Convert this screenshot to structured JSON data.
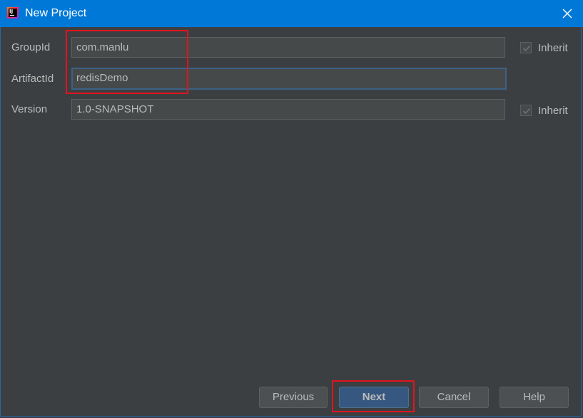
{
  "window": {
    "title": "New Project",
    "app_icon": "intellij-idea-icon",
    "close_icon": "close-icon"
  },
  "form": {
    "group_id": {
      "label": "GroupId",
      "value": "com.manlu",
      "inherit_label": "Inherit",
      "inherit_checked": true
    },
    "artifact_id": {
      "label": "ArtifactId",
      "value": "redisDemo"
    },
    "version": {
      "label": "Version",
      "value": "1.0-SNAPSHOT",
      "inherit_label": "Inherit",
      "inherit_checked": true
    }
  },
  "buttons": {
    "previous": "Previous",
    "next": "Next",
    "cancel": "Cancel",
    "help": "Help"
  },
  "colors": {
    "titlebar": "#0078d7",
    "background": "#3c3f41",
    "field": "#45494a",
    "primary_button": "#365880",
    "highlight": "#e0141e"
  }
}
